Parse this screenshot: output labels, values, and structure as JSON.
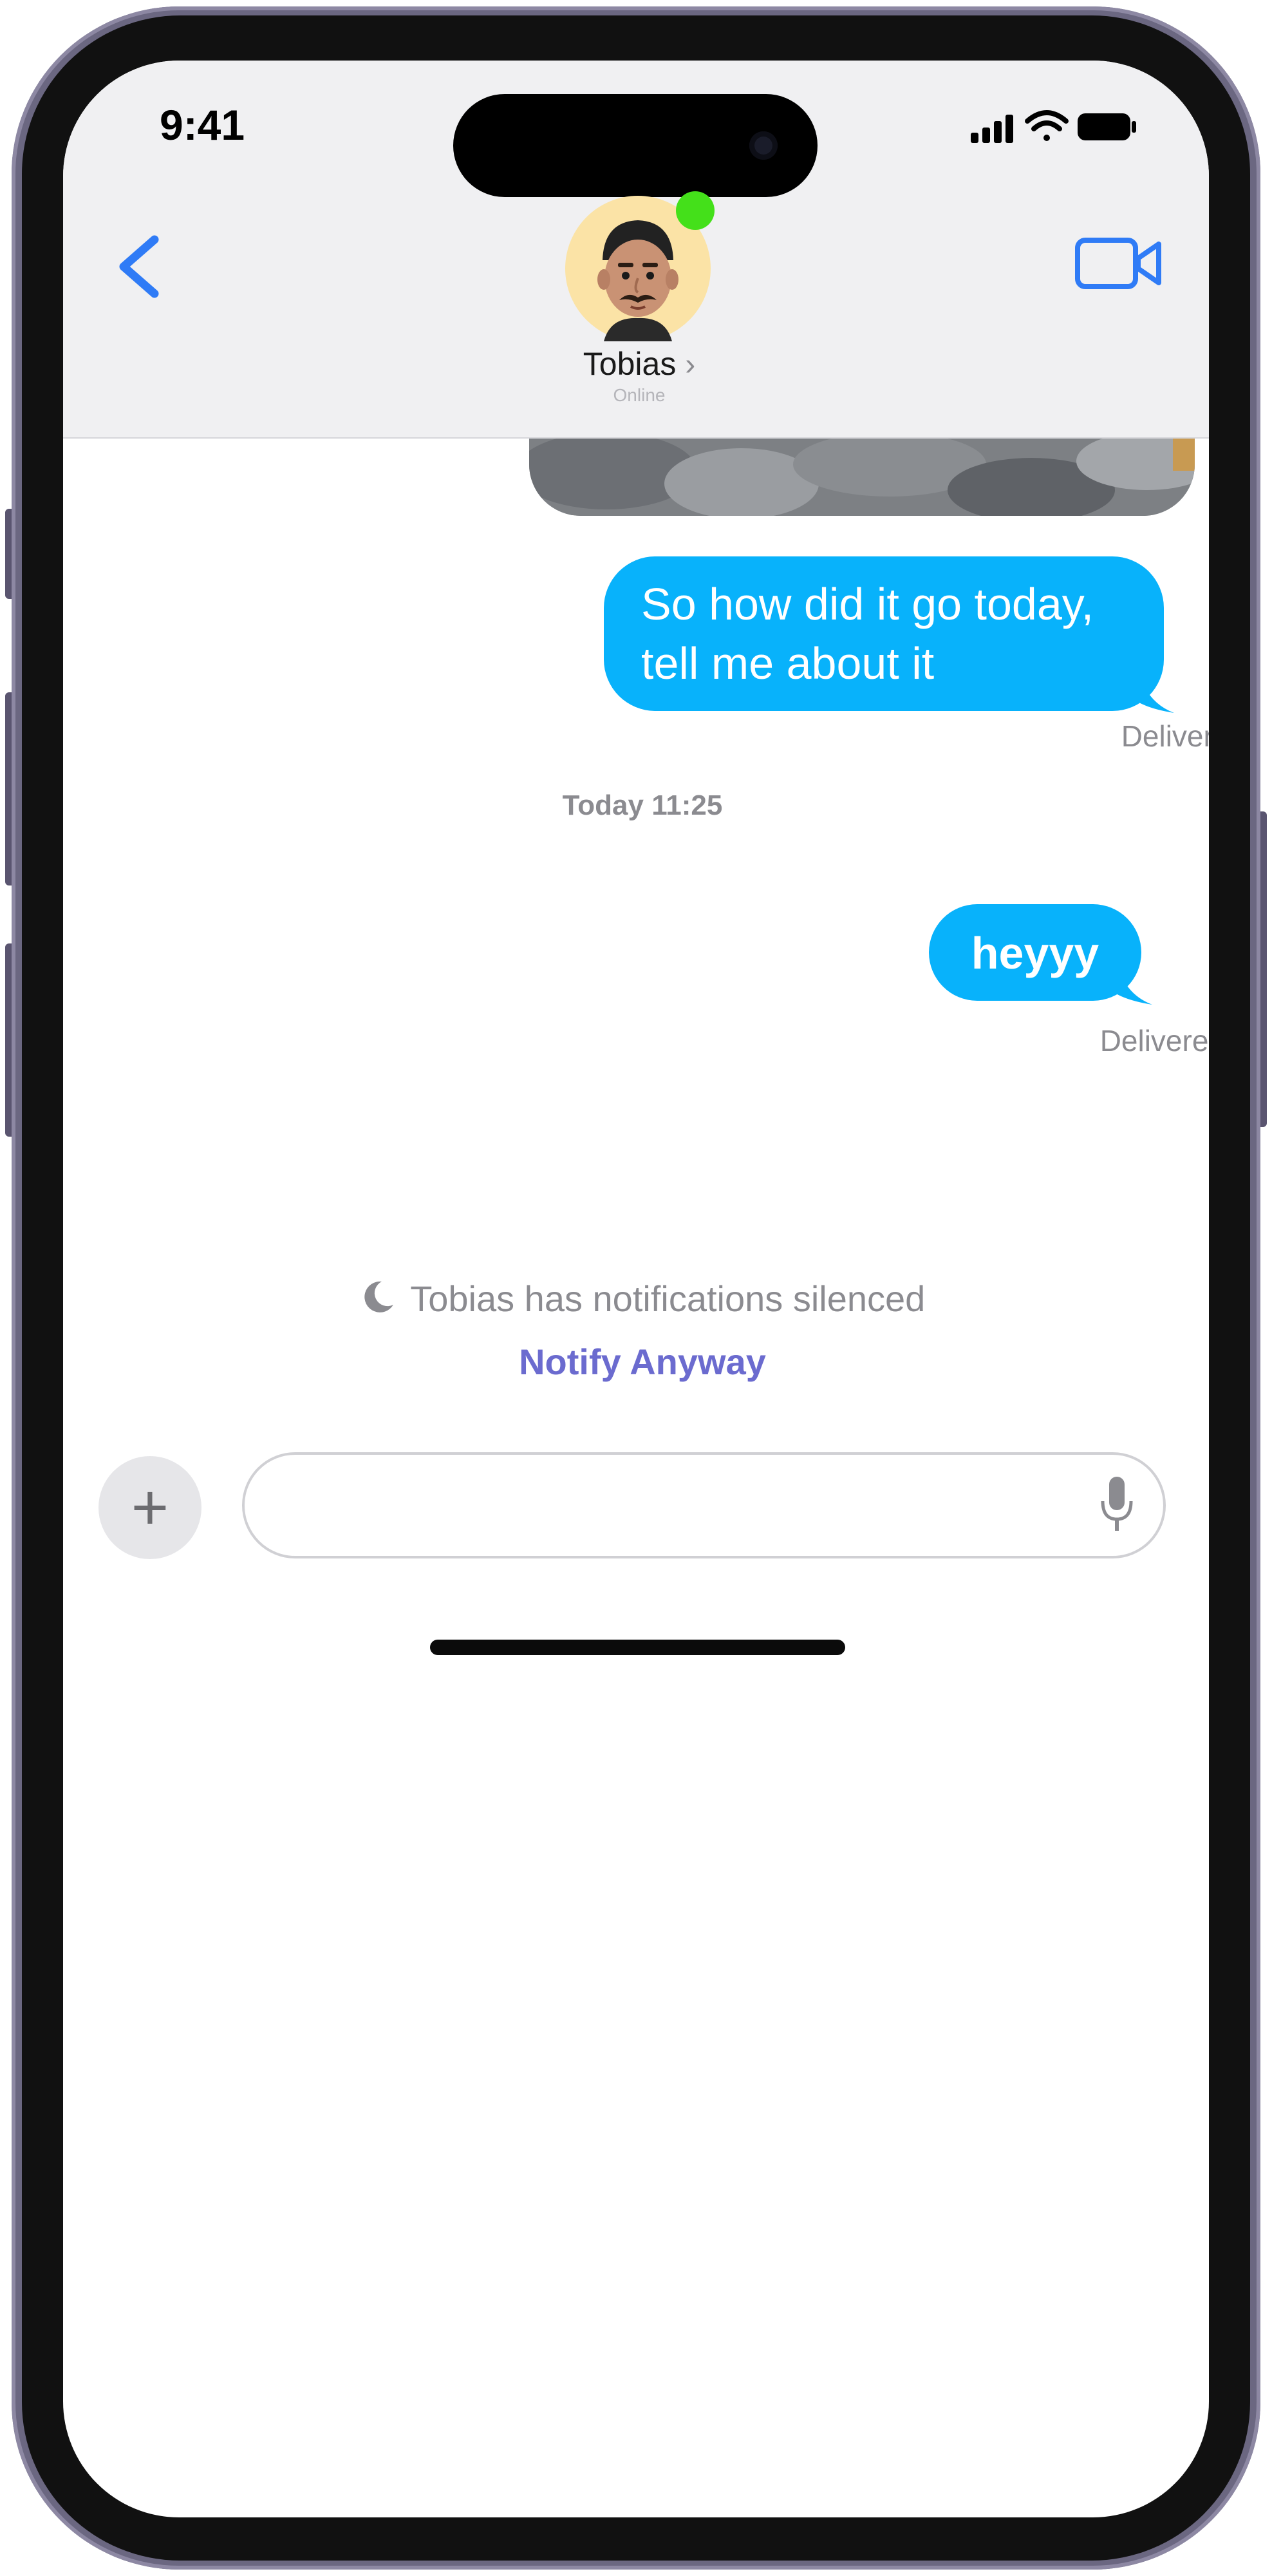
{
  "status_bar": {
    "time": "9:41"
  },
  "header": {
    "contact_name": "Tobias",
    "chevron": "›",
    "contact_status": "Online",
    "online": true
  },
  "messages": [
    {
      "type": "image",
      "direction": "outgoing"
    },
    {
      "type": "text",
      "direction": "outgoing",
      "text": "So how did it go today, tell me about it",
      "status": "Delivered"
    },
    {
      "type": "text",
      "direction": "outgoing",
      "text": "heyyy",
      "status": "Delivered"
    }
  ],
  "timestamp": "Today 11:25",
  "notice": {
    "silenced_text": "Tobias has notifications silenced",
    "notify_label": "Notify Anyway"
  },
  "composer": {
    "placeholder": "",
    "value": ""
  },
  "icons": {
    "back": "chevron-left-icon",
    "video": "video-camera-icon",
    "moon": "moon-icon",
    "plus": "plus-icon",
    "mic": "microphone-icon",
    "signal": "cellular-signal-icon",
    "wifi": "wifi-icon",
    "battery": "battery-icon"
  },
  "colors": {
    "bubble_blue": "#08b2fb",
    "accent_blue": "#2f7bf6",
    "notify_purple": "#6b6bcf",
    "online_green": "#44e01a",
    "avatar_bg": "#fbe3a6",
    "frame": "#6b6781"
  }
}
